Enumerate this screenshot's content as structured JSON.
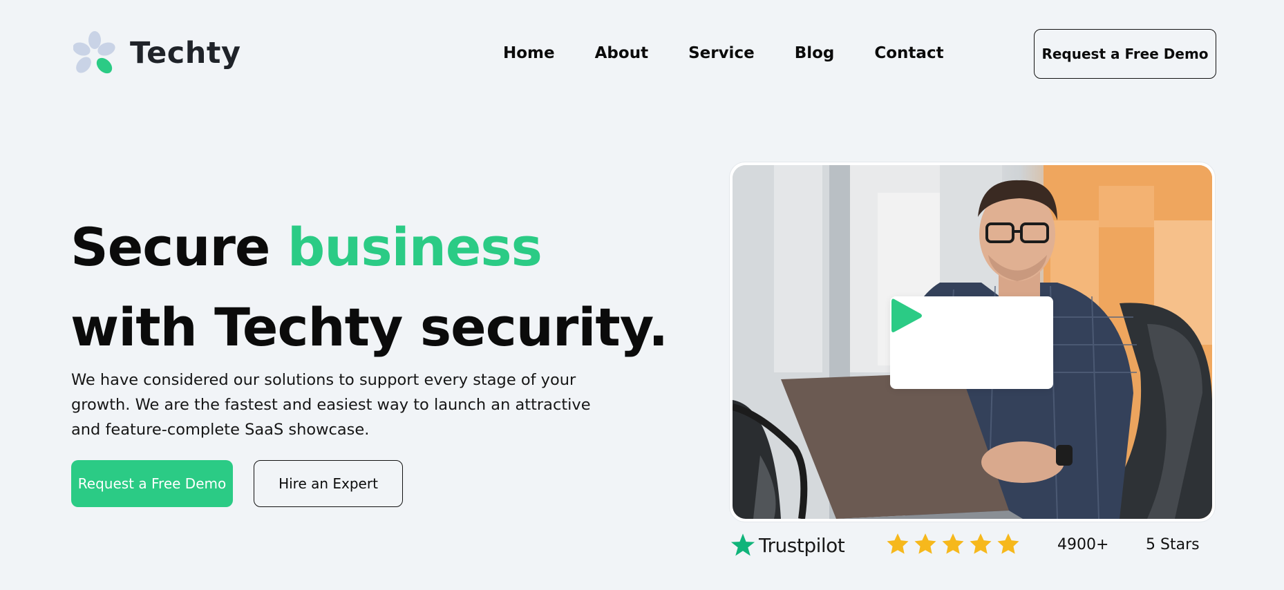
{
  "brand": {
    "name": "Techty",
    "logo_icon": "flower-petals-icon",
    "accent_color": "#2bcb85"
  },
  "nav": {
    "items": [
      {
        "label": "Home"
      },
      {
        "label": "About"
      },
      {
        "label": "Service"
      },
      {
        "label": "Blog"
      },
      {
        "label": "Contact"
      }
    ],
    "cta_label": "Request a Free Demo"
  },
  "hero": {
    "title_part1": "Secure ",
    "title_accent": "business",
    "title_line2": "with Techty security.",
    "description": "We have considered our solutions to support every stage of your growth. We are the fastest and easiest way to launch an attractive and feature-complete SaaS showcase.",
    "primary_button": "Request a Free Demo",
    "secondary_button": "Hire an Expert"
  },
  "media": {
    "play_icon": "play-icon",
    "play_color": "#2bcb85"
  },
  "trust": {
    "brand": "Trustpilot",
    "star_icon": "star-icon",
    "star_color": "#f6b81c",
    "rating_stars": 5,
    "count": "4900+",
    "rating_label": "5 Stars"
  }
}
